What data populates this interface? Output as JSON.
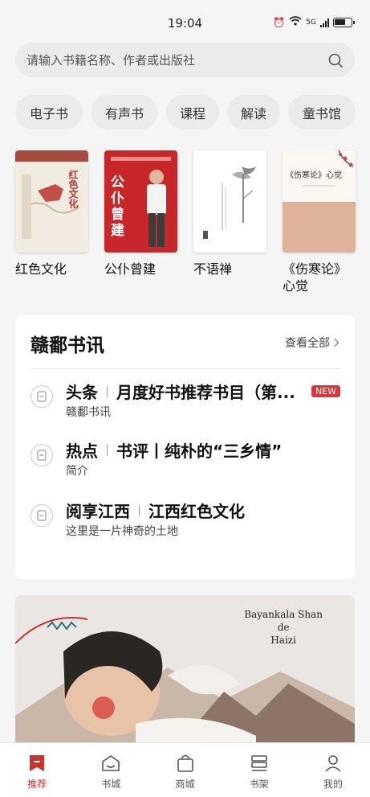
{
  "status_bar": {
    "time": "19:04",
    "network": "5G"
  },
  "search": {
    "placeholder": "请输入书籍名称、作者或出版社"
  },
  "categories": [
    "电子书",
    "有声书",
    "课程",
    "解读",
    "童书馆"
  ],
  "books": [
    {
      "title": "红色文化",
      "cover_text": "红色文化"
    },
    {
      "title": "公仆曾建",
      "cover_text": "公仆曾建"
    },
    {
      "title": "不语禅"
    },
    {
      "title": "《伤寒论》心觉",
      "cover_text": "《伤寒论》心觉"
    }
  ],
  "news": {
    "header": "赣鄱书讯",
    "more": "查看全部",
    "items": [
      {
        "category": "头条",
        "title": "月度好书推荐书目（第...",
        "subtitle": "赣鄱书讯",
        "badge": "NEW"
      },
      {
        "category": "热点",
        "title": "书评丨纯朴的“三乡情”",
        "subtitle": "简介"
      },
      {
        "category": "阅享江西",
        "title": "江西红色文化",
        "subtitle": "这里是一片神奇的土地"
      }
    ]
  },
  "banner": {
    "caption_lines": [
      "Bayankala Shan",
      "de",
      "Haizi"
    ]
  },
  "tabbar": [
    {
      "label": "推荐",
      "icon": "recommend-icon",
      "active": true
    },
    {
      "label": "书城",
      "icon": "bookstore-icon"
    },
    {
      "label": "商城",
      "icon": "shopping-bag-icon"
    },
    {
      "label": "书架",
      "icon": "bookshelf-icon"
    },
    {
      "label": "我的",
      "icon": "profile-icon"
    }
  ],
  "colors": {
    "accent": "#c8322f",
    "background": "#f5f5f5",
    "badge": "#d8363a"
  }
}
